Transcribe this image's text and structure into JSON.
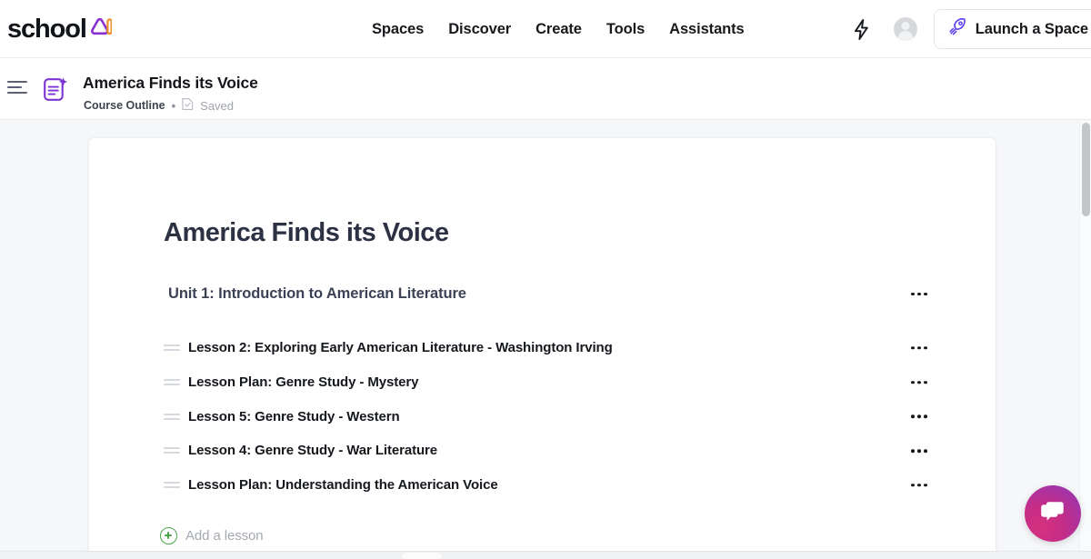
{
  "brand": {
    "word": "school",
    "mark_alt": "schoolAI-logo",
    "purple": "#7b33d6",
    "orange": "#f0922b"
  },
  "topnav": {
    "links": [
      {
        "label": "Spaces"
      },
      {
        "label": "Discover"
      },
      {
        "label": "Create"
      },
      {
        "label": "Tools"
      },
      {
        "label": "Assistants"
      }
    ],
    "bolt_icon": "lightning-bolt-icon",
    "avatar_icon": "user-avatar",
    "launch_button": {
      "label": "Launch a Space",
      "icon": "rocket-icon"
    }
  },
  "subheader": {
    "menu_icon": "hamburger-menu-icon",
    "doc_icon": "ai-document-icon",
    "title": "America Finds its Voice",
    "breadcrumb": "Course Outline",
    "separator": "•",
    "save_icon": "document-check-icon",
    "save_status": "Saved"
  },
  "document": {
    "title": "America Finds its Voice",
    "unit": {
      "title": "Unit 1: Introduction to American Literature",
      "menu_icon": "ellipsis-icon"
    },
    "lessons": [
      {
        "label": "Lesson 2: Exploring Early American Literature - Washington Irving"
      },
      {
        "label": "Lesson Plan: Genre Study - Mystery"
      },
      {
        "label": "Lesson 5: Genre Study - Western"
      },
      {
        "label": "Lesson 4: Genre Study - War Literature"
      },
      {
        "label": "Lesson Plan: Understanding the American Voice"
      }
    ],
    "add_lesson": {
      "label": "Add a lesson",
      "icon": "plus-circle-icon",
      "color": "#4ba54b"
    }
  },
  "chat": {
    "icon": "chat-bubbles-icon",
    "gradient_from": "#d6317f",
    "gradient_to": "#9734b4"
  }
}
